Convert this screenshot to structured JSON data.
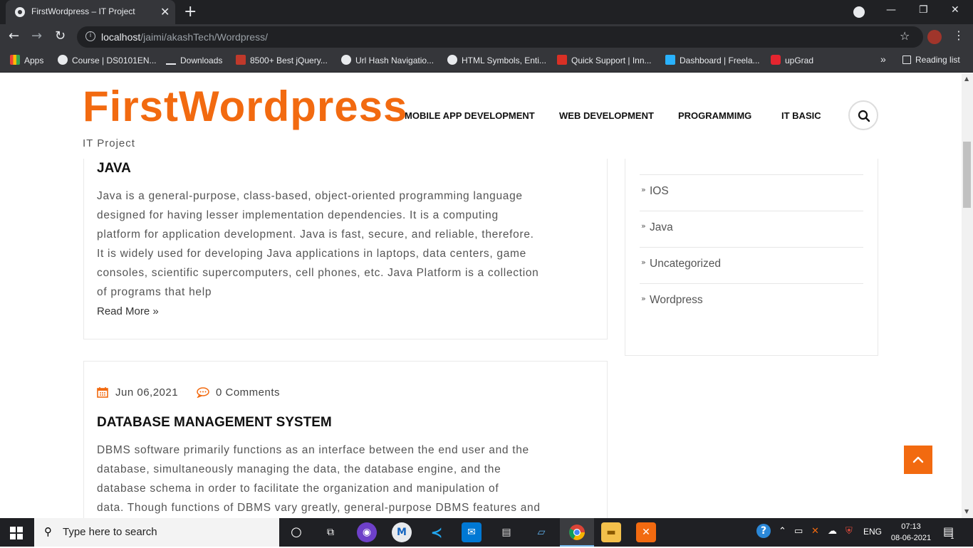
{
  "browser": {
    "tab_title": "FirstWordpress – IT Project",
    "tab_close": "✕",
    "new_tab": "+",
    "url_host": "localhost",
    "url_path": "/jaimi/akashTech/Wordpress/",
    "win_min": "—",
    "win_restore": "❐",
    "win_close": "✕",
    "back": "←",
    "forward": "→",
    "reload": "↻",
    "star": "☆",
    "menu": "⋮",
    "more_bookmarks": "»",
    "bookmarks": [
      {
        "label": "Apps",
        "icon": "apps-grid-icon",
        "color": "#ea4335"
      },
      {
        "label": "Course | DS0101EN...",
        "icon": "globe-icon",
        "color": "#e8eaed"
      },
      {
        "label": "Downloads",
        "icon": "download-icon",
        "color": "#e8eaed"
      },
      {
        "label": "8500+ Best jQuery...",
        "icon": "jr-logo-icon",
        "color": "#c0392b"
      },
      {
        "label": "Url Hash Navigatio...",
        "icon": "globe-icon",
        "color": "#e8eaed"
      },
      {
        "label": "HTML Symbols, Enti...",
        "icon": "globe-icon",
        "color": "#e8eaed"
      },
      {
        "label": "Quick Support | Inn...",
        "icon": "support-icon",
        "color": "#d93025"
      },
      {
        "label": "Dashboard | Freela...",
        "icon": "freelancer-icon",
        "color": "#29b2fe"
      },
      {
        "label": "upGrad",
        "icon": "upgrad-icon",
        "color": "#e4252f"
      }
    ],
    "reading_list": "Reading list"
  },
  "site": {
    "title": "FirstWordpress",
    "tagline": "IT Project",
    "nav": [
      "MOBILE APP DEVELOPMENT",
      "WEB DEVELOPMENT",
      "PROGRAMMIMG",
      "IT BASIC"
    ]
  },
  "posts": [
    {
      "title": "JAVA",
      "excerpt_lines": [
        "Java is a general-purpose, class-based, object-oriented programming language",
        "designed for having lesser implementation dependencies. It is a computing",
        "platform for application development. Java is fast, secure, and reliable, therefore.",
        "It is widely used for developing Java applications in laptops, data centers, game",
        "consoles, scientific supercomputers, cell phones, etc. Java Platform is a collection",
        "of programs that help"
      ],
      "read_more": "Read More »"
    },
    {
      "date": "Jun 06,2021",
      "comments": "0 Comments",
      "title": "DATABASE MANAGEMENT SYSTEM",
      "excerpt_lines": [
        "DBMS software primarily functions as an interface between the end user and the",
        "database, simultaneously managing the data, the database engine, and the",
        "database schema in order to facilitate the organization and manipulation of",
        "data. Though functions of DBMS vary greatly, general-purpose DBMS features and"
      ]
    }
  ],
  "categories": [
    "IOS",
    "Java",
    "Uncategorized",
    "Wordpress"
  ],
  "chevron": "»",
  "accent_color": "#f26a10",
  "taskbar": {
    "search_placeholder": "Type here to search",
    "lang": "ENG",
    "time": "07:13",
    "date": "08-06-2021",
    "notif_count": "1"
  }
}
